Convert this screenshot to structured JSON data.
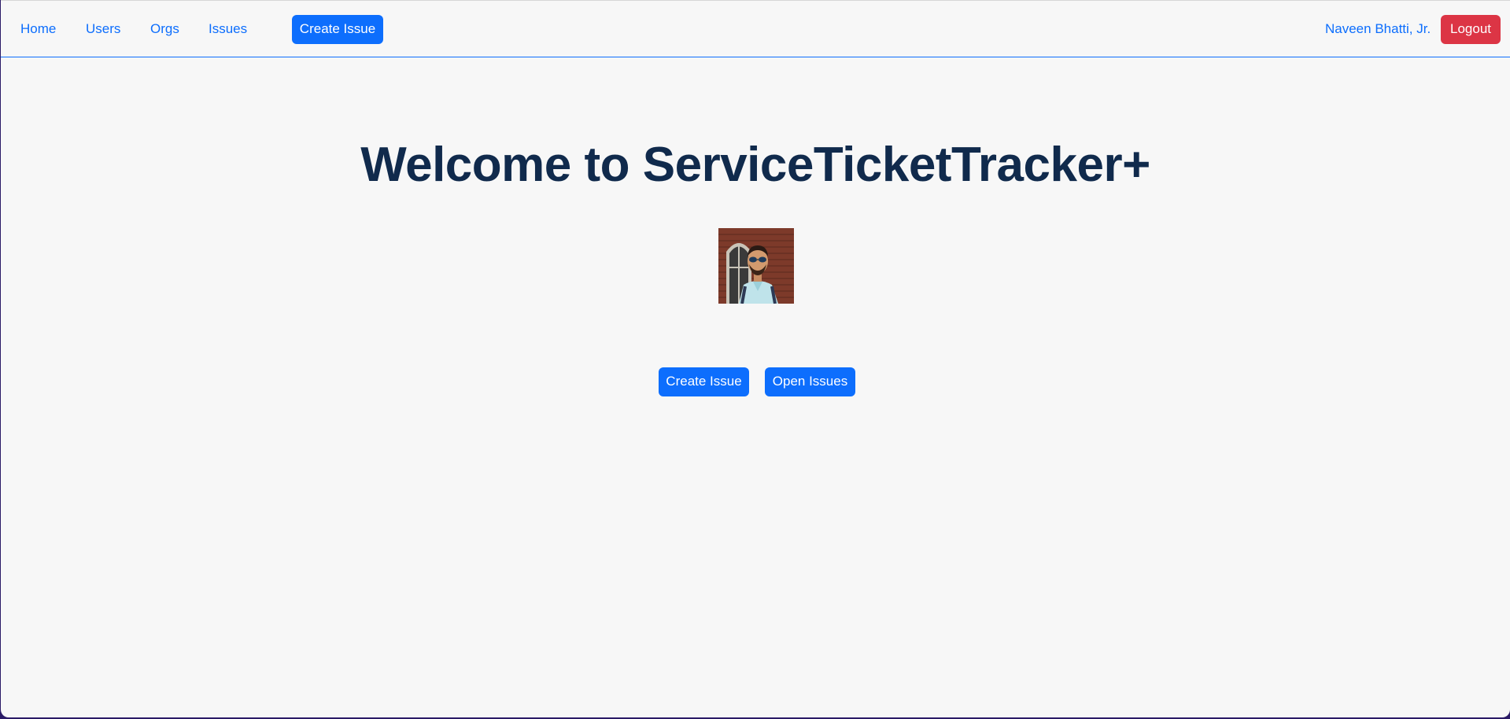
{
  "nav": {
    "links": [
      "Home",
      "Users",
      "Orgs",
      "Issues"
    ],
    "create_issue_label": "Create Issue",
    "user_name": "Naveen Bhatti, Jr.",
    "logout_label": "Logout"
  },
  "main": {
    "title": "Welcome to ServiceTicketTracker+",
    "buttons": {
      "create_issue": "Create Issue",
      "open_issues": "Open Issues"
    }
  },
  "colors": {
    "accent": "#0d6efd",
    "danger": "#dc3545",
    "title": "#102a4c",
    "background": "#f7f7f7"
  },
  "icons": {
    "avatar": "user-photo-avatar"
  }
}
